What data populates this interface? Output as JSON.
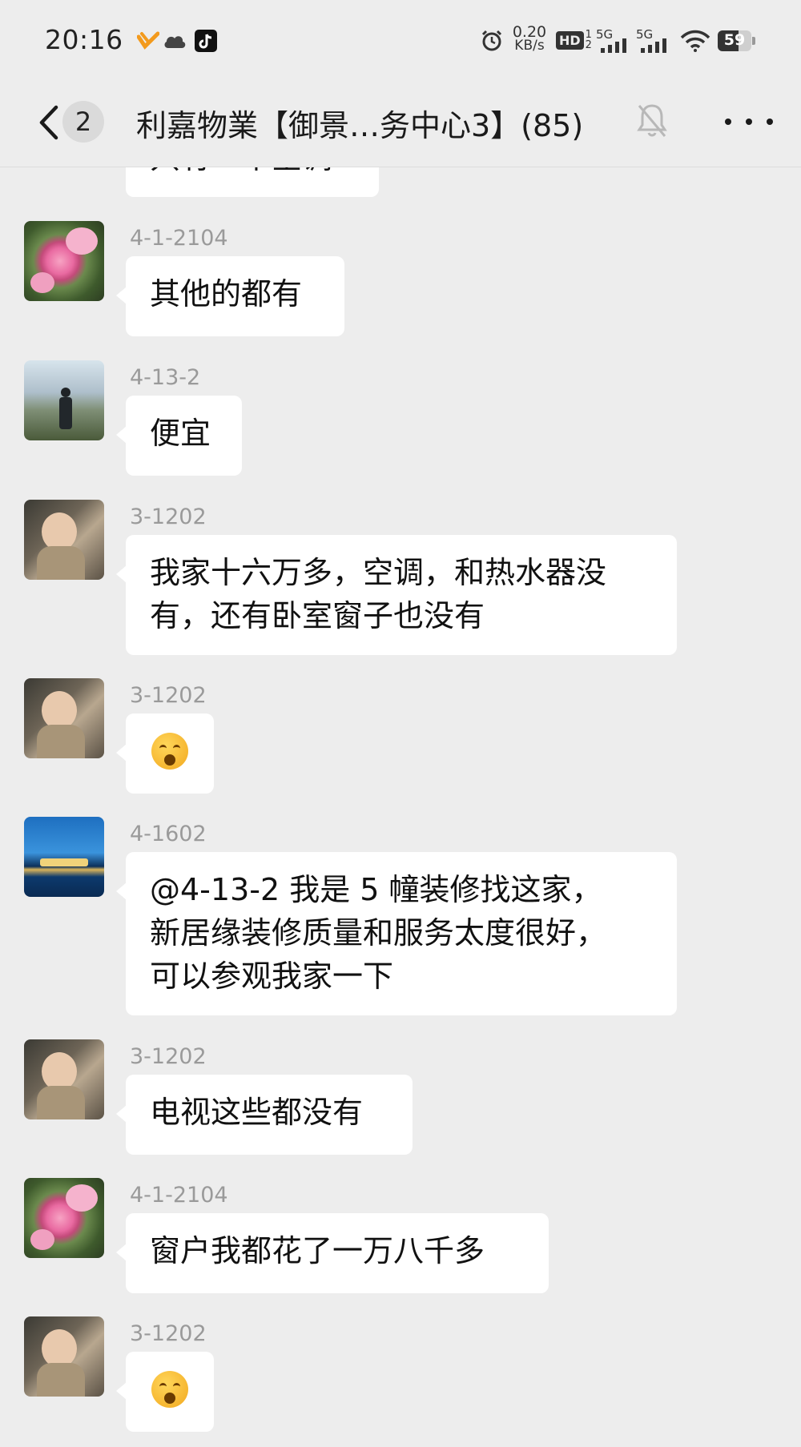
{
  "status_bar": {
    "time": "20:16",
    "net_speed_value": "0.20",
    "net_speed_unit": "KB/s",
    "hd_label": "HD",
    "sim_label_1": "1",
    "sim_label_2": "2",
    "signal_1_label": "5G",
    "signal_2_label": "5G",
    "battery": "59"
  },
  "header": {
    "unread_count": "2",
    "title": "利嘉物業【御景…务中心3】(85)"
  },
  "messages": [
    {
      "sender": "",
      "text": "只有一个空调"
    },
    {
      "sender": "4-1-2104",
      "text": "其他的都有"
    },
    {
      "sender": "4-13-2",
      "text": "便宜"
    },
    {
      "sender": "3-1202",
      "line1": "我家十六万多，空调，和热水器没",
      "line2": "有，还有卧室窗子也没有"
    },
    {
      "sender": "3-1202",
      "sticker": "yawn-emoji"
    },
    {
      "sender": "4-1602",
      "line1": "@4-13-2  我是 5 幢装修找这家，",
      "line2": "新居缘装修质量和服务太度很好，",
      "line3": "可以参观我家一下"
    },
    {
      "sender": "3-1202",
      "text": "电视这些都没有"
    },
    {
      "sender": "4-1-2104",
      "text": "窗户我都花了一万八千多"
    },
    {
      "sender": "3-1202",
      "sticker": "yawn-emoji"
    }
  ],
  "colors": {
    "background": "#ededed",
    "bubble": "#ffffff",
    "sender_text": "#9a9a9a"
  }
}
